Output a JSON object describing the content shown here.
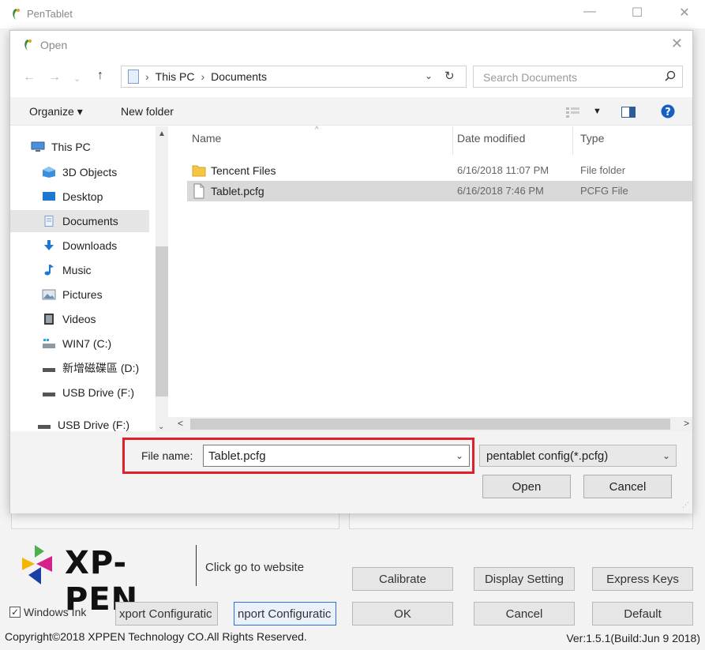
{
  "parent": {
    "title": "PenTablet",
    "minimize": "—",
    "maximize": "☐",
    "close": "✕",
    "brand": "XP-PEN",
    "go_website": "Click go to website",
    "buttons": {
      "calibrate": "Calibrate",
      "display_setting": "Display Setting",
      "express_keys": "Express Keys",
      "ok": "OK",
      "cancel": "Cancel",
      "default": "Default",
      "export_config": "xport Configuratic",
      "import_config": "nport Configuratic"
    },
    "windows_ink_label": "Windows Ink",
    "windows_ink_checked": true,
    "copyright": "Copyright©2018  XPPEN Technology CO.All Rights Reserved.",
    "version": "Ver:1.5.1(Build:Jun  9 2018)"
  },
  "dialog": {
    "title": "Open",
    "close": "✕",
    "address": {
      "crumbs": [
        "This PC",
        "Documents"
      ],
      "sep": "›"
    },
    "search_placeholder": "Search Documents",
    "toolbar": {
      "organize": "Organize ▾",
      "new_folder": "New folder"
    },
    "nav_items": [
      {
        "label": "This PC",
        "icon": "computer-icon"
      },
      {
        "label": "3D Objects",
        "icon": "cube-icon"
      },
      {
        "label": "Desktop",
        "icon": "desktop-icon"
      },
      {
        "label": "Documents",
        "icon": "documents-icon",
        "selected": true
      },
      {
        "label": "Downloads",
        "icon": "download-arrow-icon"
      },
      {
        "label": "Music",
        "icon": "music-note-icon"
      },
      {
        "label": "Pictures",
        "icon": "pictures-icon"
      },
      {
        "label": "Videos",
        "icon": "video-icon"
      },
      {
        "label": "WIN7 (C:)",
        "icon": "drive-icon"
      },
      {
        "label": "新增磁碟區 (D:)",
        "icon": "drive-icon"
      },
      {
        "label": "USB Drive (F:)",
        "icon": "usb-drive-icon"
      }
    ],
    "nav_bottom": "USB Drive (F:)",
    "columns": [
      "Name",
      "Date modified",
      "Type"
    ],
    "files": [
      {
        "name": "Tencent Files",
        "date": "6/16/2018 11:07 PM",
        "type": "File folder",
        "icon": "folder-icon"
      },
      {
        "name": "Tablet.pcfg",
        "date": "6/16/2018 7:46 PM",
        "type": "PCFG File",
        "icon": "file-icon",
        "selected": true
      }
    ],
    "file_name_label": "File name:",
    "file_name_value": "Tablet.pcfg",
    "file_type": "pentablet config(*.pcfg)",
    "open_button": "Open",
    "cancel_button": "Cancel"
  }
}
